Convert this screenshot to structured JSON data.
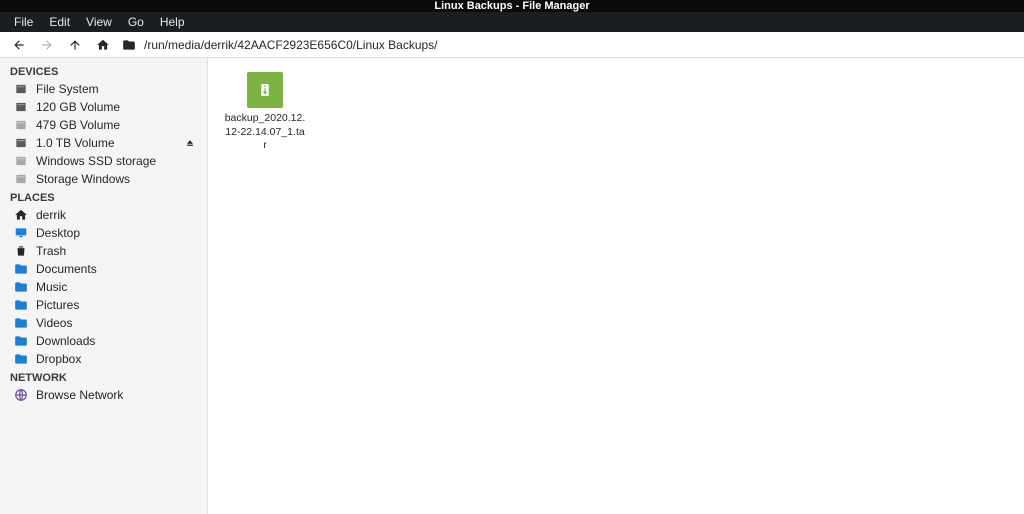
{
  "window": {
    "title": "Linux Backups - File Manager"
  },
  "menu": {
    "file": "File",
    "edit": "Edit",
    "view": "View",
    "go": "Go",
    "help": "Help"
  },
  "toolbar": {
    "path": "/run/media/derrik/42AACF2923E656C0/Linux Backups/"
  },
  "sidebar": {
    "devices": {
      "header": "DEVICES",
      "items": [
        {
          "label": "File System",
          "icon": "disk"
        },
        {
          "label": "120 GB Volume",
          "icon": "disk"
        },
        {
          "label": "479 GB Volume",
          "icon": "disk-light"
        },
        {
          "label": "1.0 TB Volume",
          "icon": "disk",
          "eject": true
        },
        {
          "label": "Windows SSD storage",
          "icon": "disk-light"
        },
        {
          "label": "Storage Windows",
          "icon": "disk-light"
        }
      ]
    },
    "places": {
      "header": "PLACES",
      "items": [
        {
          "label": "derrik",
          "icon": "home"
        },
        {
          "label": "Desktop",
          "icon": "desktop"
        },
        {
          "label": "Trash",
          "icon": "trash"
        },
        {
          "label": "Documents",
          "icon": "folder"
        },
        {
          "label": "Music",
          "icon": "folder"
        },
        {
          "label": "Pictures",
          "icon": "folder"
        },
        {
          "label": "Videos",
          "icon": "folder"
        },
        {
          "label": "Downloads",
          "icon": "folder"
        },
        {
          "label": "Dropbox",
          "icon": "folder"
        }
      ]
    },
    "network": {
      "header": "NETWORK",
      "items": [
        {
          "label": "Browse Network",
          "icon": "globe"
        }
      ]
    }
  },
  "files": [
    {
      "name": "backup_2020.12.12-22.14.07_1.tar",
      "type": "archive"
    }
  ]
}
